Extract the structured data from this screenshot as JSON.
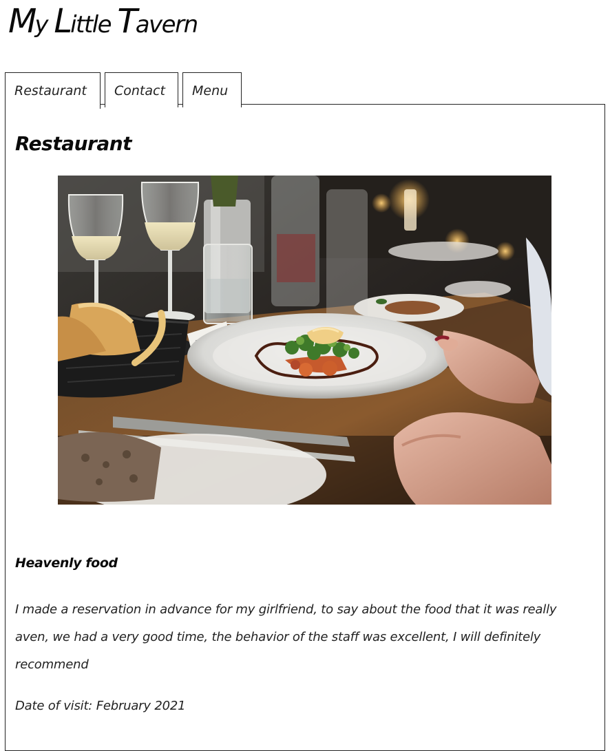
{
  "site": {
    "title_parts": [
      {
        "cap": "M",
        "rest": "y "
      },
      {
        "cap": "L",
        "rest": "ittle "
      },
      {
        "cap": "T",
        "rest": "avern"
      }
    ]
  },
  "tabs": [
    {
      "label": "Restaurant",
      "active": true
    },
    {
      "label": "Contact",
      "active": false
    },
    {
      "label": "Menu",
      "active": false
    }
  ],
  "restaurant": {
    "heading": "Restaurant",
    "review": {
      "title": "Heavenly food",
      "text": "I made a reservation in advance for my girlfriend, to say about the food that it was really aven, we had a very good time, the behavior of the staff was excellent, I will definitely recommend",
      "date": "Date of visit: February 2021"
    }
  },
  "colors": {
    "text": "#111111",
    "border": "#222222",
    "background": "#ffffff"
  }
}
